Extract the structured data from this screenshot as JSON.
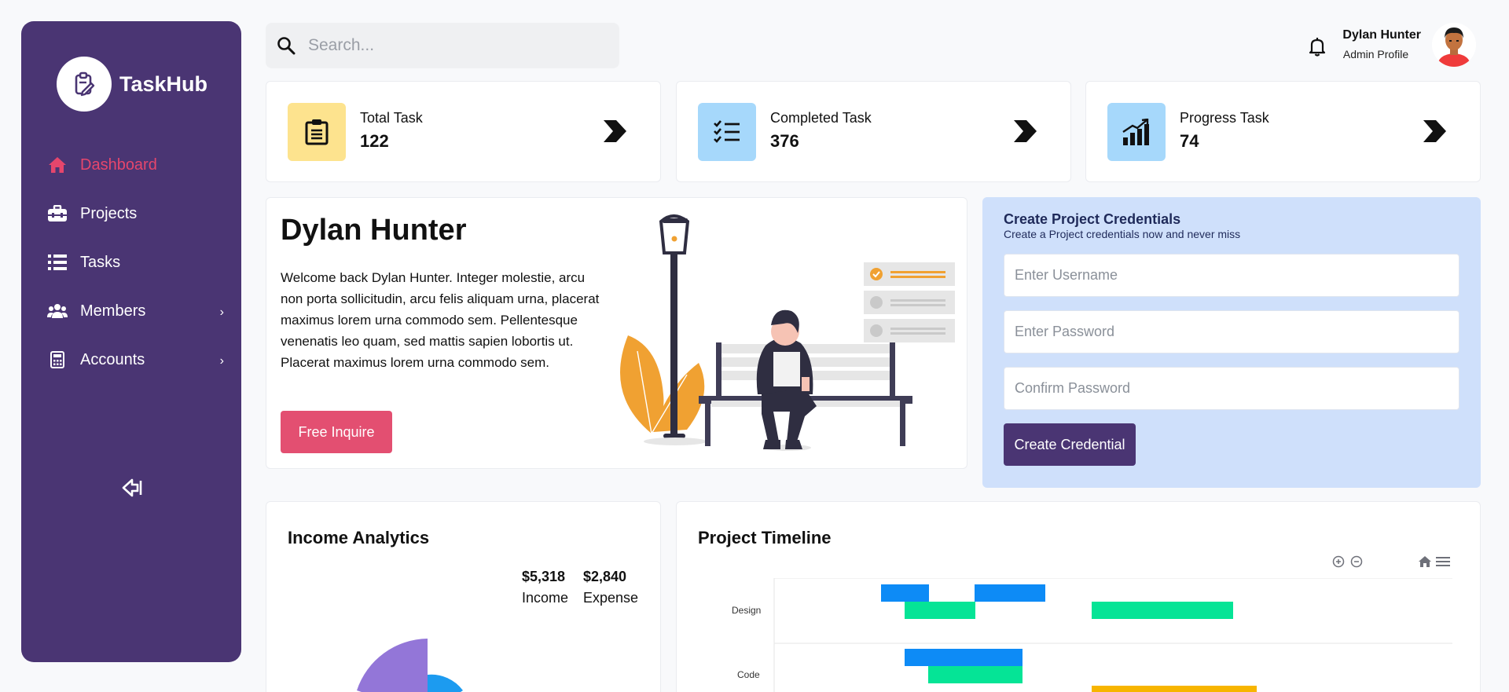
{
  "app": {
    "name": "TaskHub"
  },
  "sidebar": {
    "items": [
      {
        "label": "Dashboard",
        "icon": "home-icon",
        "active": true
      },
      {
        "label": "Projects",
        "icon": "briefcase-icon"
      },
      {
        "label": "Tasks",
        "icon": "list-icon"
      },
      {
        "label": "Members",
        "icon": "users-icon",
        "chevron": "›"
      },
      {
        "label": "Accounts",
        "icon": "calculator-icon",
        "chevron": "›"
      }
    ]
  },
  "search": {
    "placeholder": "Search..."
  },
  "user": {
    "name": "Dylan Hunter",
    "role": "Admin Profile"
  },
  "stats": [
    {
      "label": "Total Task",
      "value": "122",
      "color": "#fde38e"
    },
    {
      "label": "Completed Task",
      "value": "376",
      "color": "#a6d8fb"
    },
    {
      "label": "Progress Task",
      "value": "74",
      "color": "#a6d8fb"
    }
  ],
  "welcome": {
    "title": "Dylan Hunter",
    "text": "Welcome back Dylan Hunter. Integer molestie, arcu non porta sollicitudin, arcu felis aliquam urna, placerat maximus lorem urna commodo sem. Pellentesque venenatis leo quam, sed mattis sapien lobortis ut. Placerat maximus lorem urna commodo sem.",
    "button": "Free Inquire"
  },
  "credentials": {
    "title": "Create Project Credentials",
    "subtitle": "Create a Project credentials now and never miss",
    "username_placeholder": "Enter Username",
    "password_placeholder": "Enter Password",
    "confirm_placeholder": "Confirm Password",
    "button": "Create Credential"
  },
  "income": {
    "title": "Income Analytics",
    "income_value": "$5,318",
    "income_label": "Income",
    "expense_value": "$2,840",
    "expense_label": "Expense"
  },
  "timeline": {
    "title": "Project Timeline",
    "rows": [
      "Design",
      "Code"
    ]
  },
  "colors": {
    "sidebar": "#4a3573",
    "accent_pink": "#e34f71",
    "cred_bg": "#cfe0fb",
    "bar_blue": "#0d8bf6",
    "bar_green": "#05e496",
    "bar_yellow": "#f7b500"
  }
}
